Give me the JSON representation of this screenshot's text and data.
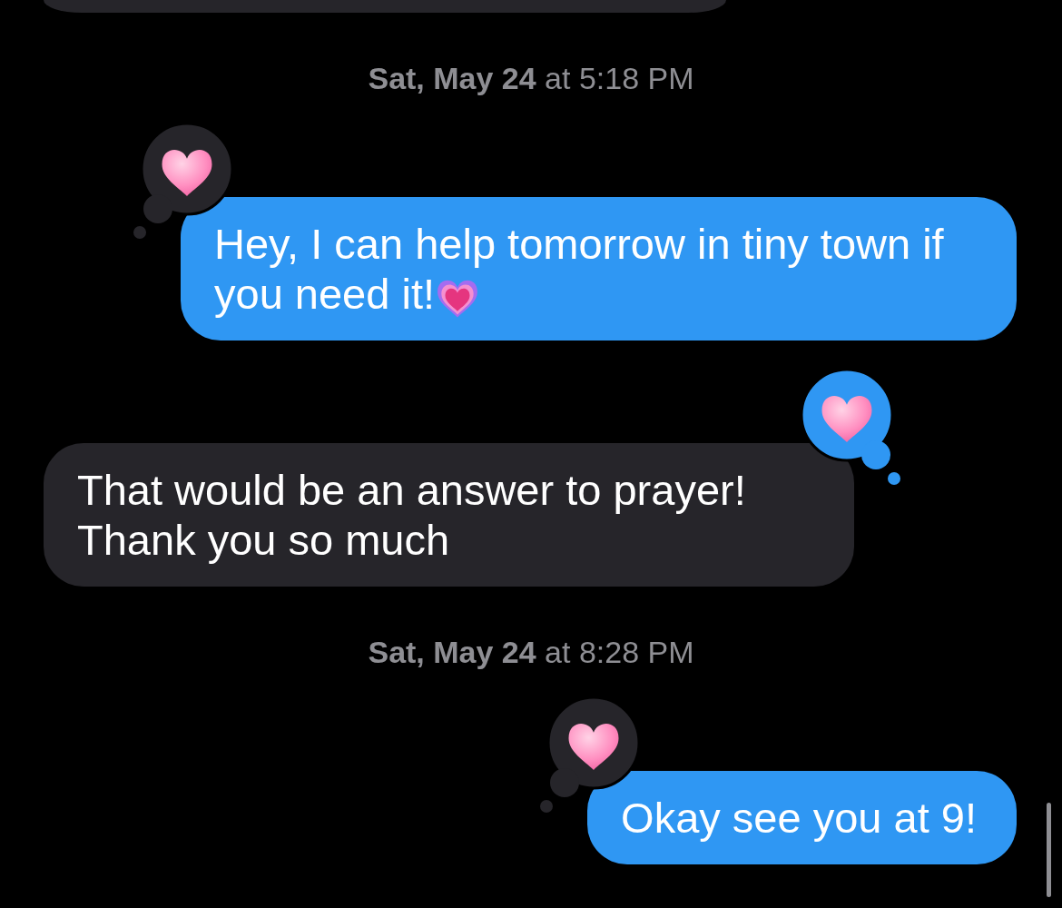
{
  "conversation": [
    {
      "kind": "cut_message",
      "from_me": false
    },
    {
      "kind": "timestamp",
      "text": "**Sat, May 24** at 5:18 PM"
    },
    {
      "kind": "message",
      "from_me": true,
      "text": "Hey, I can help tomorrow in tiny town if you need it!",
      "trailing_emoji": {
        "kind": "growing_heart"
      },
      "reaction": {
        "kind": "heart",
        "by_me": false
      }
    },
    {
      "kind": "message",
      "from_me": false,
      "text": "That would be an answer to prayer! Thank you so much",
      "reaction": {
        "kind": "heart",
        "by_me": true
      }
    },
    {
      "kind": "timestamp",
      "text": "**Sat, May 24** at 8:28 PM"
    },
    {
      "kind": "message",
      "from_me": true,
      "text": "Okay see you at 9!",
      "reaction": {
        "kind": "heart",
        "by_me": false
      }
    }
  ]
}
